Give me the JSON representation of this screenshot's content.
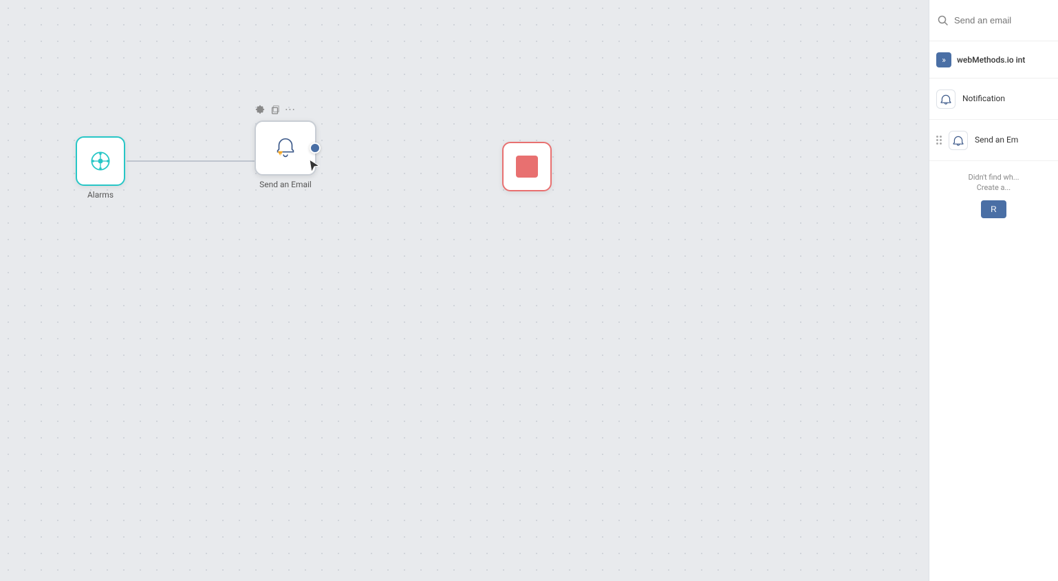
{
  "canvas": {
    "background": "#e8eaed"
  },
  "nodes": {
    "alarms": {
      "label": "Alarms"
    },
    "sendEmail": {
      "label": "Send an Email"
    },
    "stop": {
      "label": ""
    }
  },
  "rightPanel": {
    "search": {
      "placeholder": "Send an email",
      "value": "Send an email"
    },
    "sectionHeader": {
      "label": "webMethods.io int"
    },
    "results": [
      {
        "label": "Notification"
      },
      {
        "label": "Send an Em"
      }
    ],
    "notFound": {
      "text": "Didn't find wh... Create a...",
      "buttonLabel": "R"
    }
  }
}
